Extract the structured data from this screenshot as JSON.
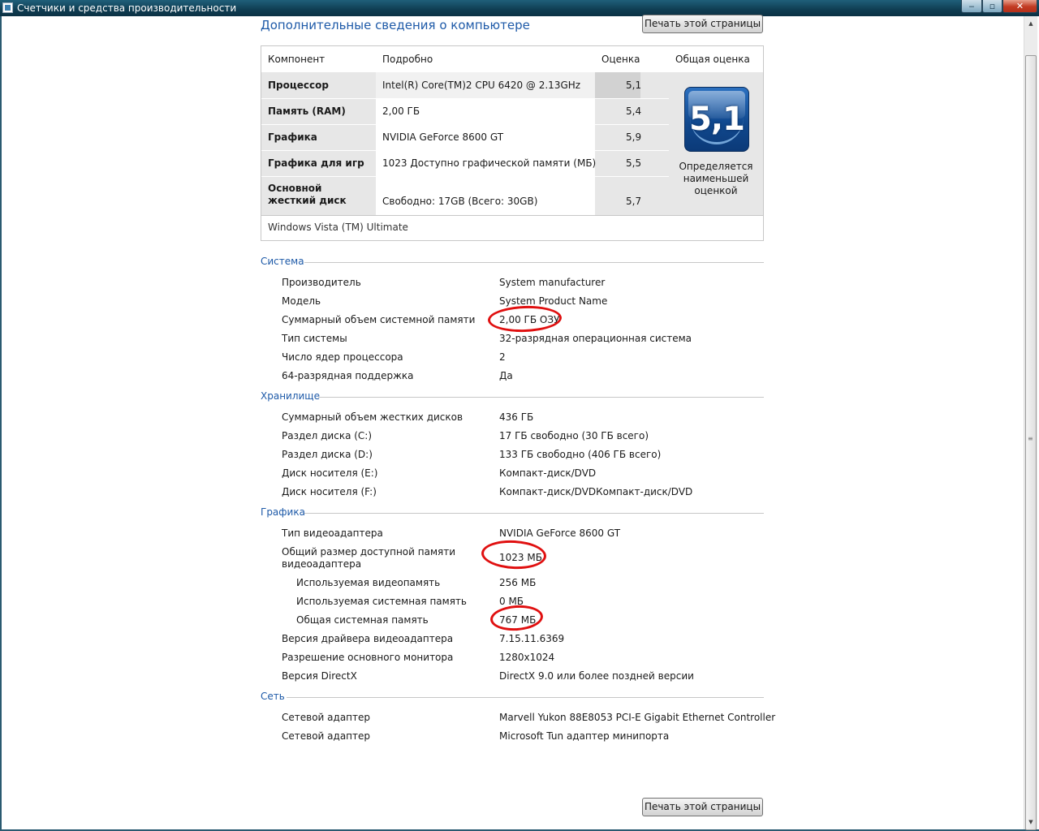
{
  "window": {
    "title": "Счетчики и средства производительности",
    "min": "‒",
    "max": "▫",
    "close": "✕"
  },
  "page": {
    "title": "Дополнительные сведения о компьютере",
    "print_label": "Печать этой страницы"
  },
  "score_table": {
    "headers": {
      "component": "Компонент",
      "details": "Подробно",
      "score": "Оценка",
      "overall": "Общая оценка"
    },
    "rows": [
      {
        "component": "Процессор",
        "details": "Intel(R) Core(TM)2 CPU 6420 @ 2.13GHz",
        "score": "5,1"
      },
      {
        "component": "Память (RAM)",
        "details": "2,00 ГБ",
        "score": "5,4"
      },
      {
        "component": "Графика",
        "details": "NVIDIA GeForce 8600 GT",
        "score": "5,9"
      },
      {
        "component": "Графика для игр",
        "details": "1023 Доступно графической памяти (МБ)",
        "score": "5,5"
      },
      {
        "component": "Основной жесткий диск",
        "details": "Свободно: 17GB (Всего: 30GB)",
        "score": "5,7"
      }
    ],
    "overall_score": "5,1",
    "overall_caption": "Определяется наименьшей оценкой",
    "os": "Windows Vista (TM) Ultimate"
  },
  "sections": [
    {
      "title": "Система",
      "items": [
        {
          "label": "Производитель",
          "value": "System manufacturer"
        },
        {
          "label": "Модель",
          "value": "System Product Name"
        },
        {
          "label": "Суммарный объем системной памяти",
          "value": "2,00 ГБ ОЗУ"
        },
        {
          "label": "Тип системы",
          "value": "32-разрядная операционная система"
        },
        {
          "label": "Число ядер процессора",
          "value": "2"
        },
        {
          "label": "64-разрядная поддержка",
          "value": "Да"
        }
      ]
    },
    {
      "title": "Хранилище",
      "items": [
        {
          "label": "Суммарный объем жестких дисков",
          "value": "436 ГБ"
        },
        {
          "label": "Раздел диска (C:)",
          "value": "17 ГБ свободно (30 ГБ всего)"
        },
        {
          "label": "Раздел диска (D:)",
          "value": "133 ГБ свободно (406 ГБ всего)"
        },
        {
          "label": "Диск носителя (E:)",
          "value": "Компакт-диск/DVD"
        },
        {
          "label": "Диск носителя (F:)",
          "value": "Компакт-диск/DVDКомпакт-диск/DVD"
        }
      ]
    },
    {
      "title": "Графика",
      "items": [
        {
          "label": "Тип видеоадаптера",
          "value": "NVIDIA GeForce 8600 GT"
        },
        {
          "label": "Общий размер доступной памяти видеоадаптера",
          "value": "1023 МБ"
        },
        {
          "label": "Используемая видеопамять",
          "value": "256 МБ"
        },
        {
          "label": "Используемая системная память",
          "value": "0 МБ"
        },
        {
          "label": "Общая системная память",
          "value": "767 МБ"
        },
        {
          "label": "Версия драйвера видеоадаптера",
          "value": "7.15.11.6369"
        },
        {
          "label": "Разрешение основного монитора",
          "value": "1280x1024"
        },
        {
          "label": "Версия DirectX",
          "value": "DirectX 9.0 или более поздней версии"
        }
      ]
    },
    {
      "title": "Сеть",
      "items": [
        {
          "label": "Сетевой адаптер",
          "value": "Marvell Yukon 88E8053 PCI-E Gigabit Ethernet Controller"
        },
        {
          "label": "Сетевой адаптер",
          "value": "Microsoft Tun адаптер минипорта"
        }
      ]
    }
  ]
}
